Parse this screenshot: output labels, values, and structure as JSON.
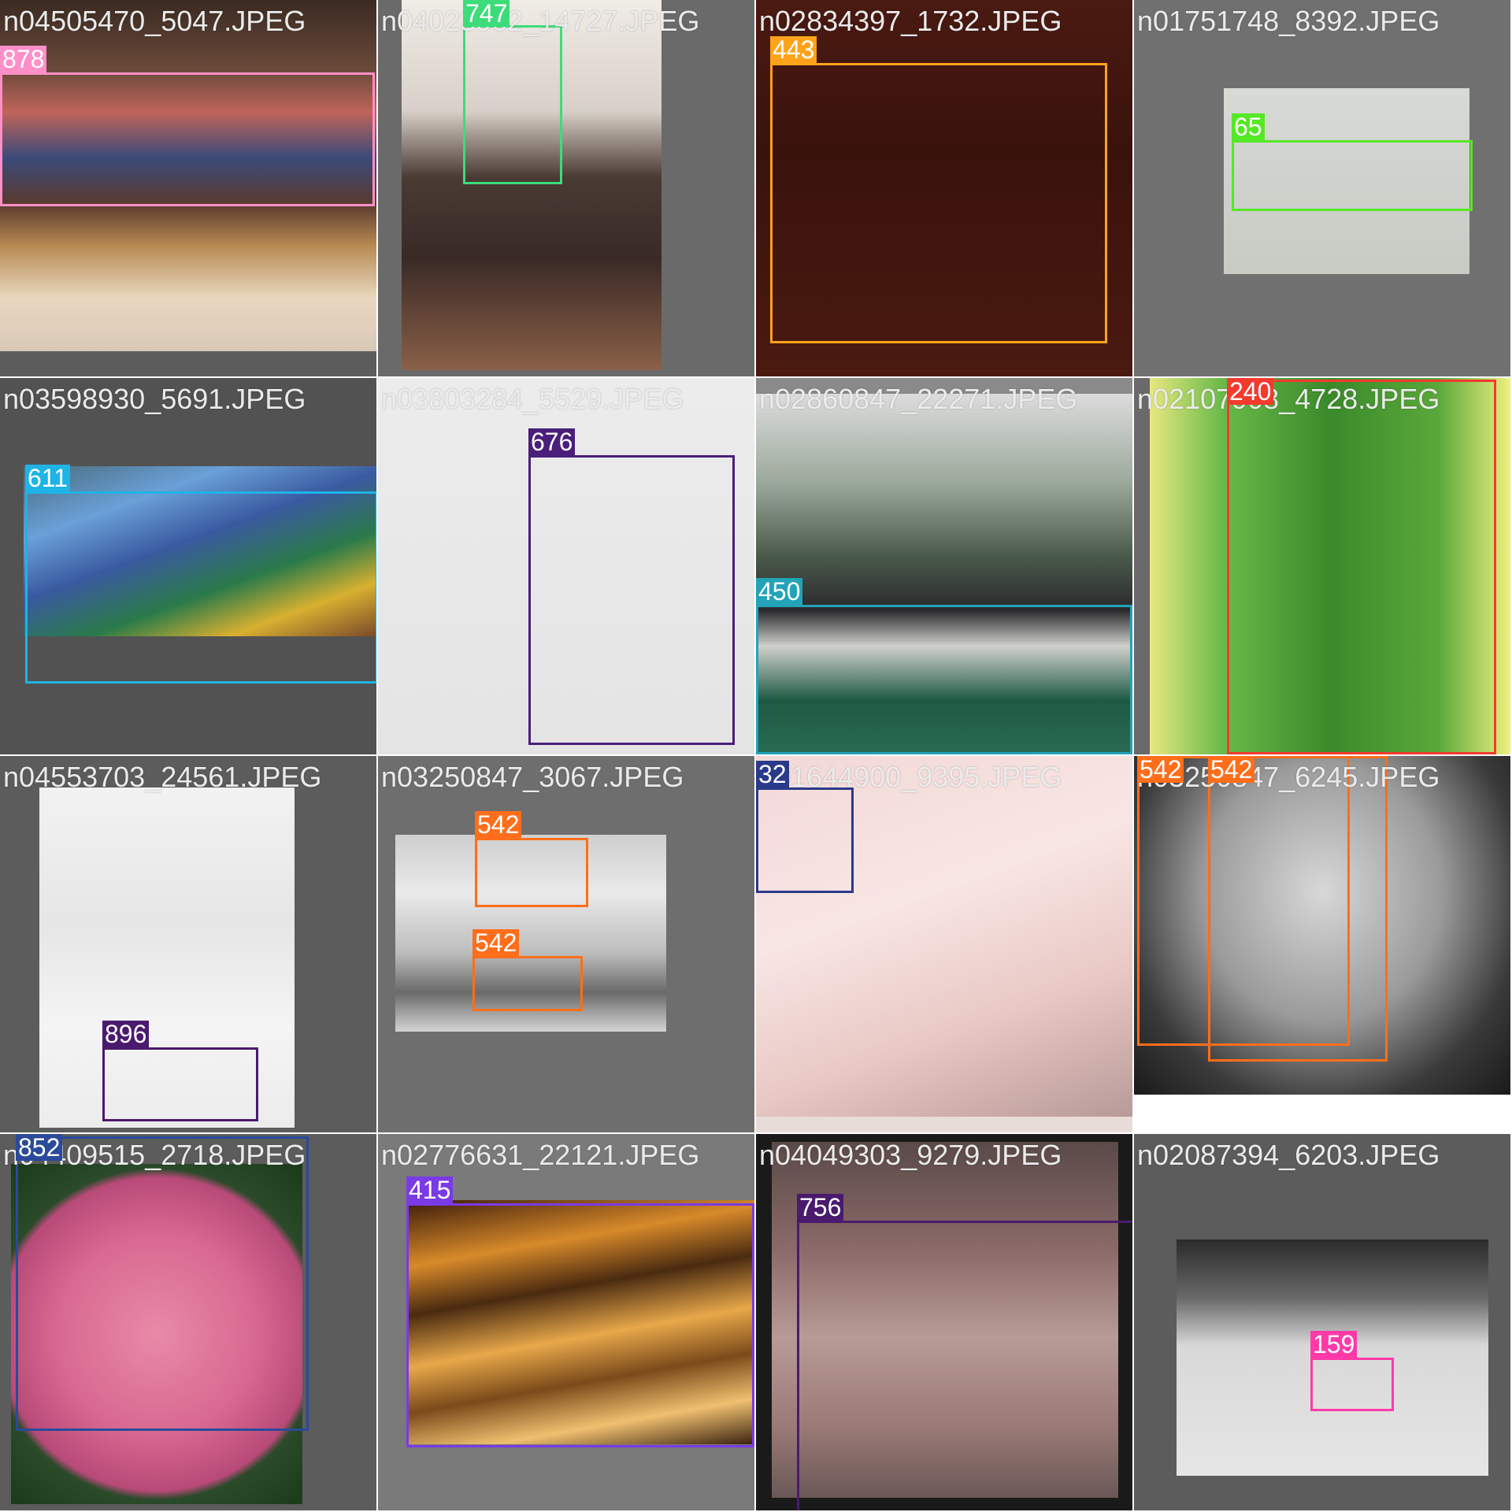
{
  "colors": {
    "divider": "#ffffff",
    "filename_text": "#ebebeb",
    "label_text": "#ffffff"
  },
  "tiles": [
    {
      "filename": "n04505470_5047.JPEG",
      "background": "#5c5c5c",
      "photo_fill": "linear-gradient(180deg,#3a2a22 0%,#6b4a3a 20%,#c0645a 32%,#3a4a7a 45%,#5a3a2e 58%,#b88a52 70%,#e8d8c0 85%,#d8c8b8 100%)",
      "detections": [
        {
          "label": "878",
          "color": "#ff8fc8"
        }
      ]
    },
    {
      "filename": "n04023962_14727.JPEG",
      "background": "#6a6a6a",
      "photo_fill": "linear-gradient(180deg,#f0ece6 0%,#d8d0c8 30%,#4a3a34 48%,#3a2a26 70%,#6a4a3a 88%,#8a6048 100%)",
      "detections": [
        {
          "label": "747",
          "color": "#3ddc7a"
        }
      ]
    },
    {
      "filename": "n02834397_1732.JPEG",
      "background": "#2e1410",
      "photo_fill": "linear-gradient(180deg,#4a1a12 0%,#3a120c 40%,#4a1a10 100%)",
      "detections": [
        {
          "label": "443",
          "color": "#ffa31a"
        }
      ]
    },
    {
      "filename": "n01751748_8392.JPEG",
      "background": "#707070",
      "photo_fill": "linear-gradient(180deg,#d8dad6 0%,#cfd1cc 50%,#c8cac4 100%)",
      "detections": [
        {
          "label": "65",
          "color": "#55e825"
        }
      ]
    },
    {
      "filename": "n03598930_5691.JPEG",
      "background": "#525252",
      "photo_fill": "linear-gradient(160deg,#4a6a7a 0%,#6aa0d8 25%,#3a5aa0 45%,#2a7a4a 65%,#d8b030 82%,#7a4a2a 100%)",
      "detections": [
        {
          "label": "611",
          "color": "#1eb4e6"
        }
      ]
    },
    {
      "filename": "n03803284_5529.JPEG",
      "background": "#e6e6e6",
      "photo_fill": "linear-gradient(180deg,#ececec 0%,#e4e4e4 100%)",
      "detections": [
        {
          "label": "676",
          "color": "#4a1e7a"
        }
      ]
    },
    {
      "filename": "n02860847_22271.JPEG",
      "background": "#8a8a8a",
      "photo_fill": "linear-gradient(180deg,#dcdcdc 0%,#9aa89a 25%,#4a5a4a 45%,#2a2a2e 60%,#d0d0cc 70%,#1e5a44 85%,#2a6a52 100%)",
      "detections": [
        {
          "label": "450",
          "color": "#22a3b8"
        }
      ]
    },
    {
      "filename": "n02107908_4728.JPEG",
      "background": "#6a6a6a",
      "photo_fill": "linear-gradient(90deg,#e8e880 0%,#6aba4a 20%,#3a8a2a 50%,#5aa83a 80%,#f0f080 100%)",
      "detections": [
        {
          "label": "240",
          "color": "#f23a2e"
        }
      ]
    },
    {
      "filename": "n04553703_24561.JPEG",
      "background": "#5c5c5c",
      "photo_fill": "linear-gradient(180deg,#f2f2f2 0%,#e6e6e6 40%,#f4f4f4 70%,#ececec 100%)",
      "detections": [
        {
          "label": "896",
          "color": "#4a1a6e"
        }
      ]
    },
    {
      "filename": "n03250847_3067.JPEG",
      "background": "#6e6e6e",
      "photo_fill": "linear-gradient(180deg,#cfcfcf 0%,#eaeaea 30%,#bdbdbd 60%,#6a6a6a 80%,#d4d4d4 100%)",
      "detections": [
        {
          "label": "542",
          "color": "#ff6e1a"
        },
        {
          "label": "542",
          "color": "#ff6e1a"
        }
      ]
    },
    {
      "filename": "n01644900_9395.JPEG",
      "background": "#e8dcd8",
      "photo_fill": "linear-gradient(160deg,#f2d8d6 0%,#f8e6e4 40%,#e8c8c4 70%,#b89a98 100%)",
      "detections": [
        {
          "label": "32",
          "color": "#2a3a8a"
        }
      ]
    },
    {
      "filename": "n03250847_6245.JPEG",
      "background": "#ffffff",
      "photo_fill": "radial-gradient(ellipse at 50% 40%,#d8d8d8 0%,#9a9a9a 45%,#3a3a3a 75%,#1a1a1a 100%)",
      "detections": [
        {
          "label": "542",
          "color": "#ff6e1a"
        },
        {
          "label": "542",
          "color": "#ff6e1a"
        }
      ]
    },
    {
      "filename": "n04409515_2718.JPEG",
      "background": "#5c5c5c",
      "photo_fill": "radial-gradient(circle at 50% 50%,#e88aa8 0%,#d86890 45%,#b84a78 70%,#2a4a2a 74%,#1a3a1a 100%)",
      "detections": [
        {
          "label": "852",
          "color": "#2a4a9a"
        }
      ]
    },
    {
      "filename": "n02776631_22121.JPEG",
      "background": "#7a7a7a",
      "photo_fill": "linear-gradient(170deg,#3a1a0a 0%,#d88a2a 22%,#4a2a10 38%,#e8a84a 55%,#7a4a1a 70%,#f0c070 85%,#3a2210 100%)",
      "detections": [
        {
          "label": "415",
          "color": "#7a3ae6"
        }
      ]
    },
    {
      "filename": "n04049303_9279.JPEG",
      "background": "#1a1a1a",
      "photo_fill": "linear-gradient(180deg,#5a4a48 0%,#8a6a68 30%,#b89a96 55%,#9a7a76 80%,#6a5856 100%)",
      "detections": [
        {
          "label": "756",
          "color": "#4a1a6e"
        }
      ]
    },
    {
      "filename": "n02087394_6203.JPEG",
      "background": "#5c5c5c",
      "photo_fill": "linear-gradient(180deg,#2a2a2a 0%,#6a6a6a 25%,#d8d8d8 45%,#e6e6e6 100%)",
      "detections": [
        {
          "label": "159",
          "color": "#ff3aa8"
        }
      ]
    }
  ]
}
